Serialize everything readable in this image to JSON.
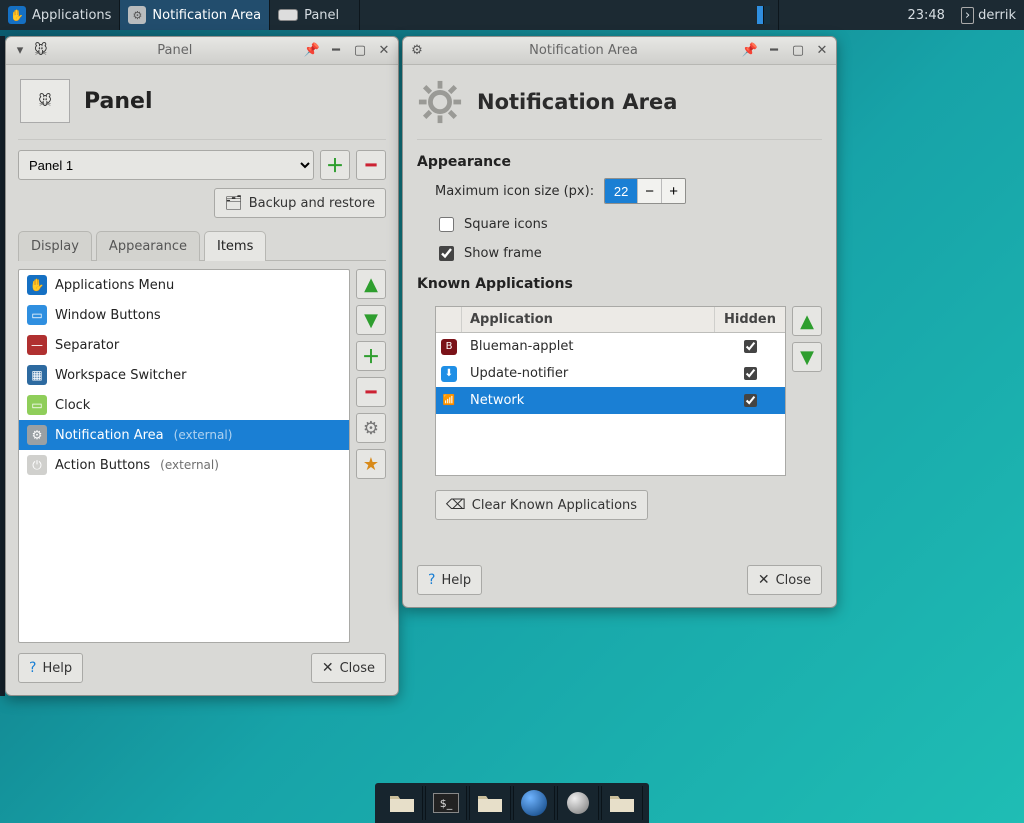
{
  "top_panel": {
    "apps_label": "Applications",
    "task_active": "Notification Area",
    "task_other": "Panel",
    "clock": "23:48",
    "user": "derrik"
  },
  "panel_window": {
    "titlebar": "Panel",
    "heading": "Panel",
    "combo_value": "Panel 1",
    "backup_btn": "Backup and restore",
    "tabs": {
      "display": "Display",
      "appearance": "Appearance",
      "items": "Items"
    },
    "items": [
      {
        "label": "Applications Menu",
        "ext": "",
        "icon_bg": "#1570c3",
        "glyph": "✋"
      },
      {
        "label": "Window Buttons",
        "ext": "",
        "icon_bg": "#2f8fe0",
        "glyph": "▭"
      },
      {
        "label": "Separator",
        "ext": "",
        "icon_bg": "#b03030",
        "glyph": "—"
      },
      {
        "label": "Workspace Switcher",
        "ext": "",
        "icon_bg": "#2d6aa0",
        "glyph": "▦"
      },
      {
        "label": "Clock",
        "ext": "",
        "icon_bg": "#8fce5a",
        "glyph": "▭"
      },
      {
        "label": "Notification Area",
        "ext": "(external)",
        "icon_bg": "#9aa0a4",
        "glyph": "⚙",
        "selected": true
      },
      {
        "label": "Action Buttons",
        "ext": "(external)",
        "icon_bg": "#d0d0cd",
        "glyph": "⏻"
      }
    ],
    "help_btn": "Help",
    "close_btn": "Close"
  },
  "notif_window": {
    "titlebar": "Notification Area",
    "heading": "Notification Area",
    "section_appearance": "Appearance",
    "max_icon_label": "Maximum icon size (px):",
    "max_icon_value": "22",
    "square_icons_label": "Square icons",
    "square_icons_checked": false,
    "show_frame_label": "Show frame",
    "show_frame_checked": true,
    "section_known": "Known Applications",
    "col_app": "Application",
    "col_hidden": "Hidden",
    "apps": [
      {
        "name": "Blueman-applet",
        "icon_bg": "#7a1218",
        "glyph": "B",
        "hidden": true
      },
      {
        "name": "Update-notifier",
        "icon_bg": "#1f8fe6",
        "glyph": "⬇",
        "hidden": true
      },
      {
        "name": "Network",
        "icon_bg": "#1a7fd4",
        "glyph": "📶",
        "hidden": true,
        "selected": true
      }
    ],
    "clear_btn": "Clear Known Applications",
    "help_btn": "Help",
    "close_btn": "Close"
  },
  "dock": {
    "items": [
      "file-manager",
      "terminal",
      "file-manager-2",
      "web-browser",
      "search",
      "file-manager-3"
    ]
  }
}
